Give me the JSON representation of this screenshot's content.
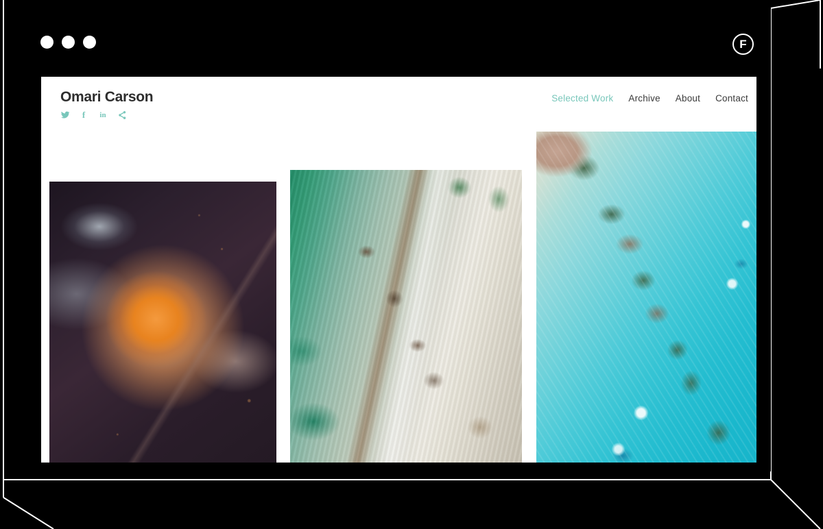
{
  "window": {
    "traffic_lights": [
      "close-dot",
      "minimize-dot",
      "maximize-dot"
    ],
    "brand_logo_letter": "F"
  },
  "site": {
    "title": "Omari Carson",
    "social": [
      {
        "name": "twitter-icon",
        "glyph": "twitter"
      },
      {
        "name": "facebook-icon",
        "glyph": "f"
      },
      {
        "name": "linkedin-icon",
        "glyph": "in"
      },
      {
        "name": "share-icon",
        "glyph": "share"
      }
    ],
    "nav": [
      {
        "label": "Selected Work",
        "active": true
      },
      {
        "label": "Archive",
        "active": false
      },
      {
        "label": "About",
        "active": false
      },
      {
        "label": "Contact",
        "active": false
      }
    ]
  },
  "gallery": {
    "items": [
      {
        "name": "artwork-ink-swirl",
        "alt": "Dark purple ink bloom with orange swirl"
      },
      {
        "name": "artwork-aerial-coastline",
        "alt": "Aerial view of green coastal shallows and sand spit"
      },
      {
        "name": "artwork-turquoise-cays",
        "alt": "Aerial view of turquoise sea and sandy cays"
      }
    ]
  },
  "colors": {
    "accent_teal": "#79c7bb",
    "text_dark": "#3a3a3a",
    "page_background": "#000000",
    "viewport_background": "#ffffff",
    "frame_line": "#ffffff"
  }
}
